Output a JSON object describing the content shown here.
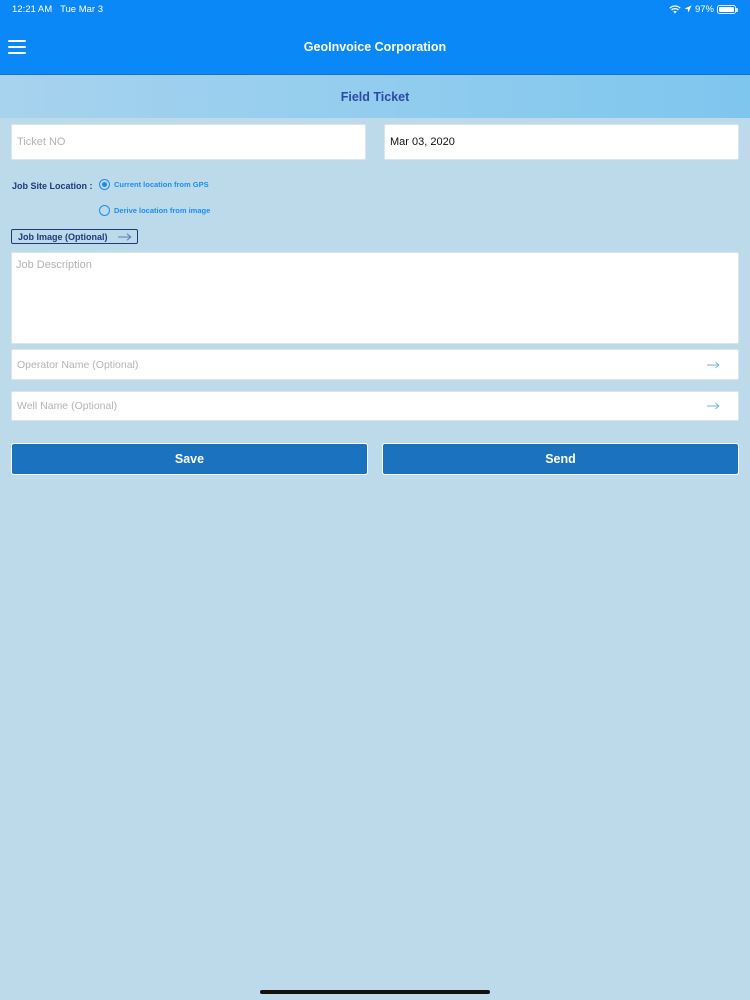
{
  "status_bar": {
    "time": "12:21 AM",
    "date": "Tue Mar 3",
    "battery": "97%",
    "battery_level": 0.97
  },
  "header": {
    "title": "GeoInvoice Corporation",
    "menu_icon": "hamburger-menu-icon"
  },
  "subheader": {
    "title": "Field Ticket"
  },
  "form": {
    "ticket_no_placeholder": "Ticket NO",
    "ticket_no_value": "",
    "date_value": "Mar 03, 2020",
    "location_label": "Job Site Location :",
    "location_options": [
      {
        "label": "Current location from GPS",
        "selected": true
      },
      {
        "label": "Derive location from image",
        "selected": false
      }
    ],
    "job_image_label": "Job Image (Optional)",
    "job_description_placeholder": "Job Description",
    "operator_name_placeholder": "Operator Name (Optional)",
    "well_name_placeholder": "Well Name (Optional)"
  },
  "actions": {
    "save_label": "Save",
    "send_label": "Send"
  },
  "colors": {
    "nav_blue": "#0b88f7",
    "background": "#bcdaea",
    "button_blue": "#1b73c0",
    "accent": "#1a8df5",
    "dark_label": "#1c3a7a"
  }
}
